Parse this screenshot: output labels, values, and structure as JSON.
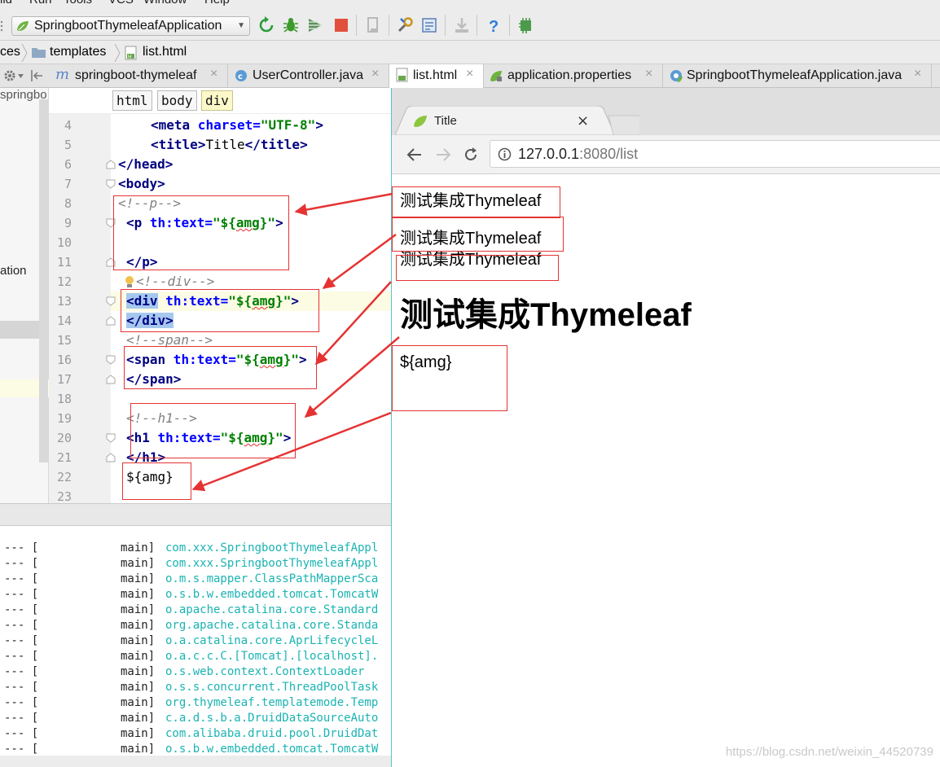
{
  "ide": {
    "menu": [
      "ild",
      "Run",
      "Tools",
      "VCS",
      "Window",
      "Help"
    ],
    "run_configuration": "SpringbootThymeleafApplication",
    "breadcrumbs": [
      "ces",
      "templates",
      "list.html"
    ],
    "tabs": [
      {
        "label": "springboot-thymeleaf",
        "icon": "module-icon"
      },
      {
        "label": "UserController.java",
        "icon": "java-class-icon"
      },
      {
        "label": "list.html",
        "icon": "html-file-icon",
        "active": true
      },
      {
        "label": "application.properties",
        "icon": "spring-properties-icon"
      },
      {
        "label": "SpringbootThymeleafApplication.java",
        "icon": "spring-class-icon"
      }
    ],
    "tab_close": "×",
    "project_panel": {
      "item_top": "springbo",
      "item_mid": "ation"
    },
    "editor_path": [
      "html",
      "body",
      "div"
    ],
    "line_numbers": [
      "4",
      "5",
      "6",
      "7",
      "8",
      "9",
      "10",
      "11",
      "12",
      "13",
      "14",
      "15",
      "16",
      "17",
      "18",
      "19",
      "20",
      "21",
      "22",
      "23"
    ],
    "code": {
      "l4": {
        "open": "<",
        "tag": "meta",
        "attr": " charset=",
        "str": "\"UTF-8\"",
        "close": ">"
      },
      "l5": {
        "open": "<",
        "tag": "title",
        "close": ">",
        "text": "Title",
        "open2": "</",
        "tag2": "title",
        "close2": ">"
      },
      "l6": {
        "text": "</head>"
      },
      "l7": {
        "text": "<body>"
      },
      "l8": {
        "text": "<!--p-->"
      },
      "l9": {
        "open": "<",
        "tag": "p",
        "attr": " th:text=",
        "str_a": "\"${",
        "squig": "amg",
        "str_b": "}\"",
        "close": ">"
      },
      "l11": {
        "text": "</p>"
      },
      "l12": {
        "text": "<!--div-->"
      },
      "l13": {
        "open": "<",
        "tag": "div",
        "attr": " th:text=",
        "str_a": "\"${",
        "squig": "amg",
        "str_b": "}\"",
        "close": ">"
      },
      "l14": {
        "text": "</div>"
      },
      "l15": {
        "text": "<!--span-->"
      },
      "l16": {
        "open": "<",
        "tag": "span",
        "attr": " th:text=",
        "str_a": "\"${",
        "squig": "amg",
        "str_b": "}\"",
        "close": ">"
      },
      "l17": {
        "text": "</span>"
      },
      "l19": {
        "text": "<!--h1-->"
      },
      "l20": {
        "open": "<",
        "tag": "h1",
        "attr": " th:text=",
        "str_a": "\"${",
        "squig": "amg",
        "str_b": "}\"",
        "close": ">"
      },
      "l21": {
        "text": "</h1>"
      },
      "l22": {
        "text": "${amg}"
      }
    },
    "console": {
      "separator": "--- [",
      "thread": "main]",
      "loggers": [
        "com.xxx.SpringbootThymeleafAppl",
        "com.xxx.SpringbootThymeleafAppl",
        "o.m.s.mapper.ClassPathMapperSca",
        "o.s.b.w.embedded.tomcat.TomcatW",
        "o.apache.catalina.core.Standard",
        "org.apache.catalina.core.Standa",
        "o.a.catalina.core.AprLifecycleL",
        "o.a.c.c.C.[Tomcat].[localhost].",
        "o.s.web.context.ContextLoader",
        "o.s.s.concurrent.ThreadPoolTask",
        "org.thymeleaf.templatemode.Temp",
        "c.a.d.s.b.a.DruidDataSourceAuto",
        "com.alibaba.druid.pool.DruidDat",
        "o.s.b.w.embedded.tomcat.TomcatW"
      ]
    }
  },
  "browser": {
    "tab_title": "Title",
    "tab_close": "×",
    "url_host": "127.0.0.1",
    "url_rest": ":8080/list",
    "output": {
      "p": "测试集成Thymeleaf",
      "div": "测试集成Thymeleaf",
      "span": "测试集成Thymeleaf",
      "h1": "测试集成Thymeleaf",
      "raw": "${amg}"
    }
  },
  "watermark": "https://blog.csdn.net/weixin_44520739",
  "colors": {
    "annotation": "#e53333",
    "tag": "#000080",
    "attribute": "#0000ff",
    "string": "#008000",
    "comment": "#808080",
    "logger": "#1bb3b3"
  }
}
